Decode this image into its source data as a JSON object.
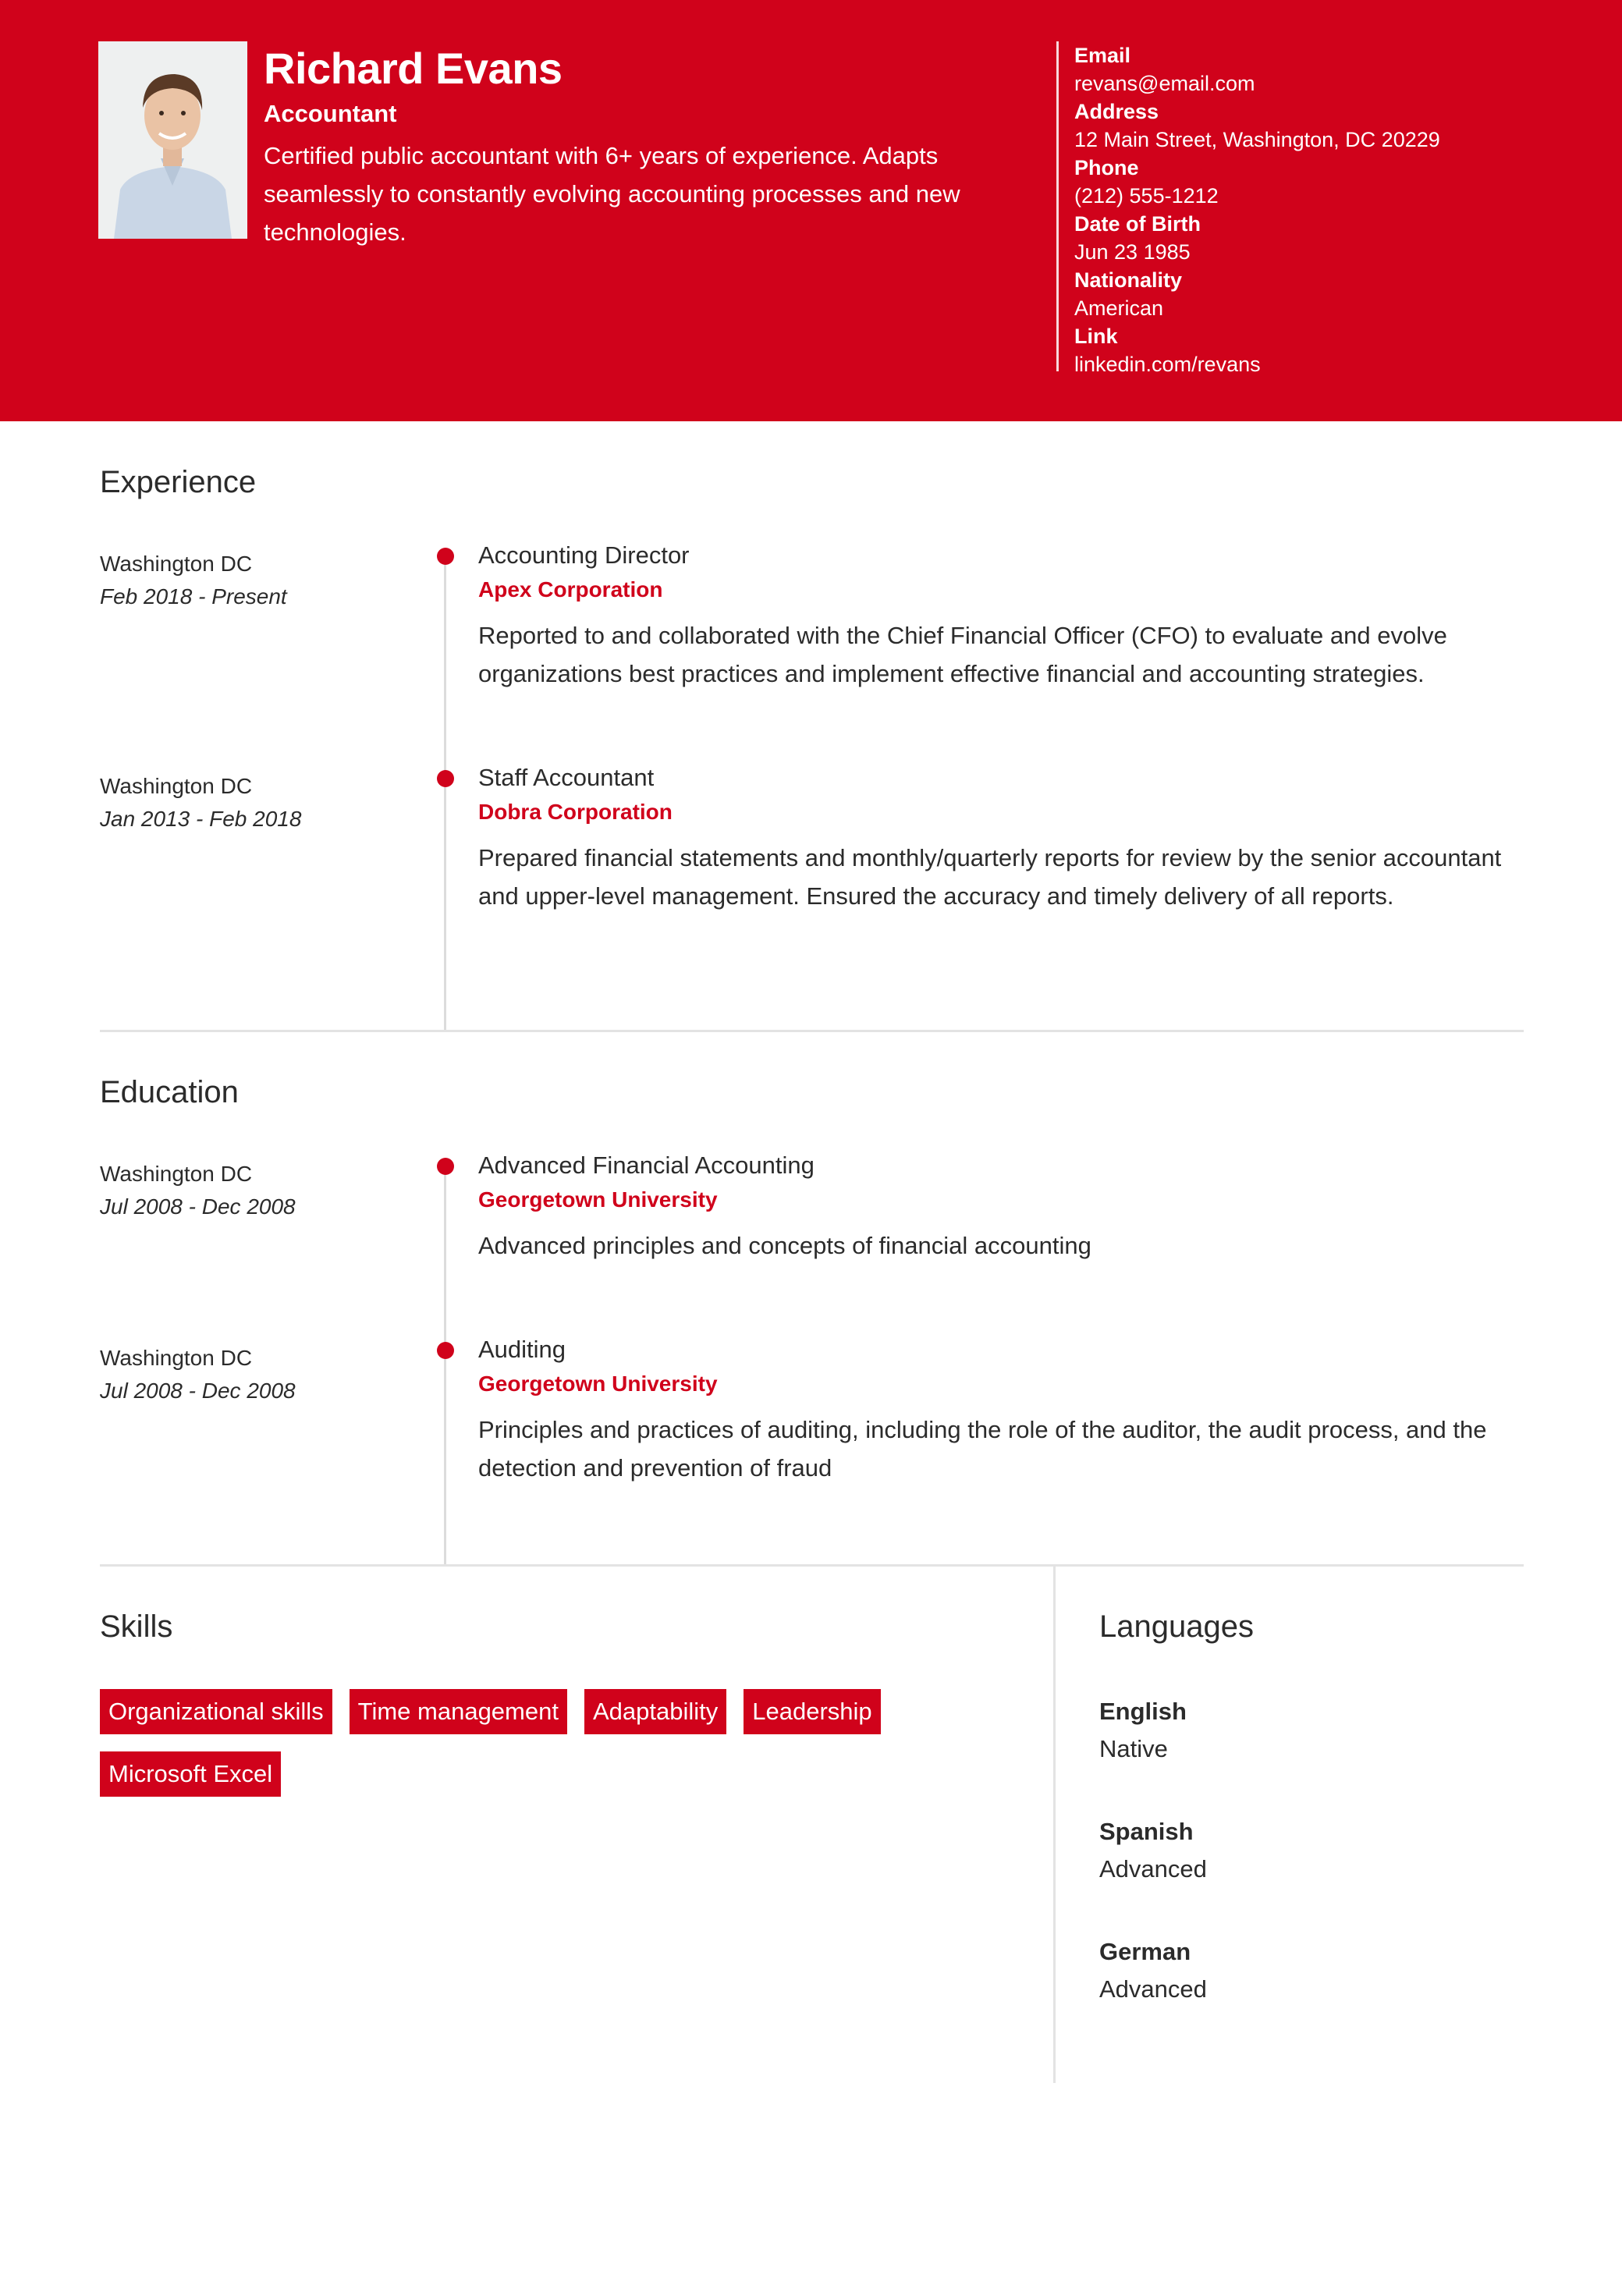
{
  "header": {
    "name": "Richard Evans",
    "job_title": "Accountant",
    "summary": "Certified public accountant with 6+ years of experience. Adapts seamlessly to constantly evolving accounting processes and new technologies.",
    "photo_alt": "profile-photo"
  },
  "contact": [
    {
      "label": "Email",
      "value": "revans@email.com"
    },
    {
      "label": "Address",
      "value": "12 Main Street, Washington, DC 20229"
    },
    {
      "label": "Phone",
      "value": "(212) 555-1212"
    },
    {
      "label": "Date of Birth",
      "value": "Jun 23 1985"
    },
    {
      "label": "Nationality",
      "value": "American"
    },
    {
      "label": "Link",
      "value": "linkedin.com/revans"
    }
  ],
  "experience": {
    "title": "Experience",
    "items": [
      {
        "location": "Washington DC",
        "dates": "Feb 2018 - Present",
        "role": "Accounting Director",
        "organization": "Apex Corporation",
        "description": "Reported to and collaborated with the Chief Financial Officer (CFO) to evaluate and evolve organizations best practices and implement effective financial and accounting strategies."
      },
      {
        "location": "Washington DC",
        "dates": "Jan 2013 - Feb 2018",
        "role": "Staff Accountant",
        "organization": "Dobra Corporation",
        "description": "Prepared financial statements and monthly/quarterly reports for review by the senior accountant and upper-level management. Ensured the accuracy and timely delivery of all reports."
      }
    ]
  },
  "education": {
    "title": "Education",
    "items": [
      {
        "location": "Washington DC",
        "dates": "Jul 2008 - Dec 2008",
        "role": "Advanced Financial Accounting",
        "organization": "Georgetown University",
        "description": "Advanced principles and concepts of financial accounting"
      },
      {
        "location": "Washington DC",
        "dates": "Jul 2008 - Dec 2008",
        "role": "Auditing",
        "organization": "Georgetown University",
        "description": "Principles and practices of auditing, including the role of the auditor, the audit process, and the detection and prevention of fraud"
      }
    ]
  },
  "skills": {
    "title": "Skills",
    "items": [
      "Organizational skills",
      "Time management",
      "Adaptability",
      "Leadership",
      "Microsoft Excel"
    ]
  },
  "languages": {
    "title": "Languages",
    "items": [
      {
        "name": "English",
        "level": "Native"
      },
      {
        "name": "Spanish",
        "level": "Advanced"
      },
      {
        "name": "German",
        "level": "Advanced"
      }
    ]
  },
  "colors": {
    "accent": "#d0021b",
    "text": "#2b2b2b",
    "divider": "#e3e3e3"
  }
}
